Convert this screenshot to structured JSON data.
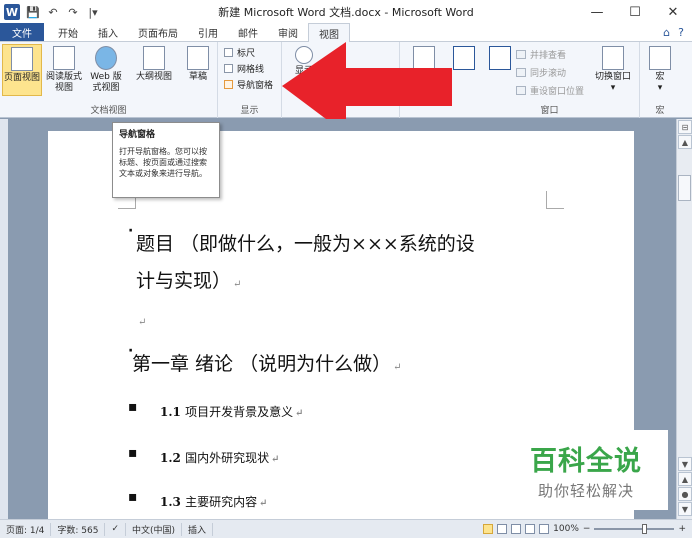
{
  "window": {
    "title": "新建 Microsoft Word 文档.docx - Microsoft Word",
    "app_icon": "W",
    "minimize": "—",
    "maximize": "☐",
    "close": "✕"
  },
  "qat": {
    "save": "💾",
    "undo": "↶",
    "redo": "↷",
    "customize": "|▾"
  },
  "tabs": [
    {
      "label": "文件"
    },
    {
      "label": "开始"
    },
    {
      "label": "插入"
    },
    {
      "label": "页面布局"
    },
    {
      "label": "引用"
    },
    {
      "label": "邮件"
    },
    {
      "label": "审阅"
    },
    {
      "label": "视图"
    }
  ],
  "ribbon": {
    "views": {
      "label": "文档视图",
      "items": [
        "页面视图",
        "阅读版式视图",
        "Web 版式视图",
        "大纲视图",
        "草稿"
      ]
    },
    "show": {
      "label": "显示",
      "items": [
        "标尺",
        "网格线",
        "导航窗格"
      ]
    },
    "zoom_partial": "显示",
    "window": {
      "label": "窗口",
      "items": [
        "并排查看",
        "同步滚动",
        "重设窗口位置"
      ],
      "switch": "切换窗口"
    },
    "macro": {
      "label": "宏",
      "button": "宏"
    }
  },
  "tooltip": {
    "title": "导航窗格",
    "body": "打开导航窗格。您可以按标题、按页面或通过搜索文本或对象来进行导航。"
  },
  "document": {
    "title_line1": "题目 （即做什么，一般为×××系统的设",
    "title_line2": "计与实现）",
    "chapter": "第一章  绪论 （说明为什么做）",
    "sections": [
      {
        "num": "1.1",
        "text": "项目开发背景及意义"
      },
      {
        "num": "1.2",
        "text": "国内外研究现状"
      },
      {
        "num": "1.3",
        "text": "主要研究内容"
      }
    ],
    "para_mark": "↵"
  },
  "watermark": {
    "main": "百科全说",
    "sub": "助你轻松解决"
  },
  "status": {
    "page": "页面: 1/4",
    "words": "字数: 565",
    "language": "中文(中国)",
    "mode": "插入",
    "zoom": "100%",
    "zoom_minus": "−",
    "zoom_plus": "+"
  },
  "colors": {
    "accent": "#2b579a",
    "selected": "#fde48e",
    "arrow": "#e8222a",
    "watermark_green": "#3aa64a"
  }
}
